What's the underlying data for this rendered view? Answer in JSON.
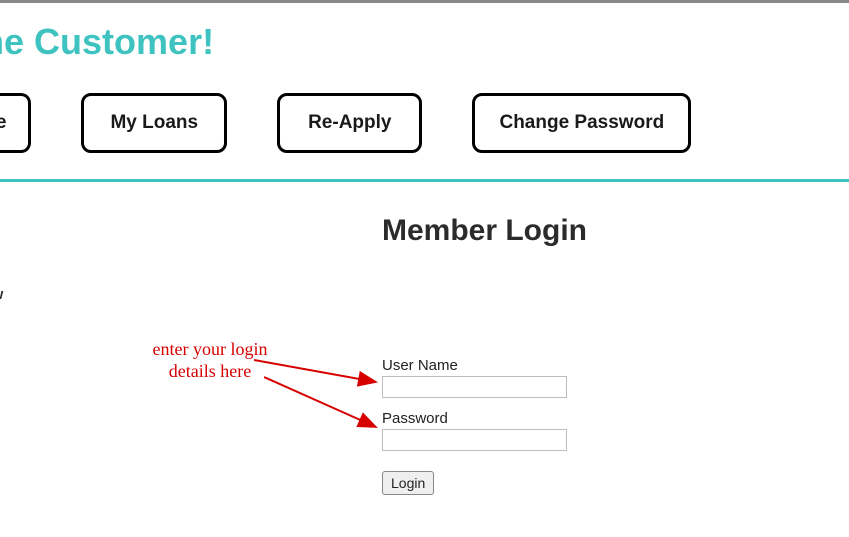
{
  "header": {
    "title": "come Customer!"
  },
  "nav": {
    "profile": "rofile",
    "myloans": "My Loans",
    "reapply": "Re-Apply",
    "changepw": "Change Password"
  },
  "login": {
    "title": "Member Login",
    "subtext": "elow",
    "username_label": "User Name",
    "password_label": "Password",
    "button": "Login"
  },
  "annotation": {
    "line1": "enter your login",
    "line2": "details here"
  }
}
